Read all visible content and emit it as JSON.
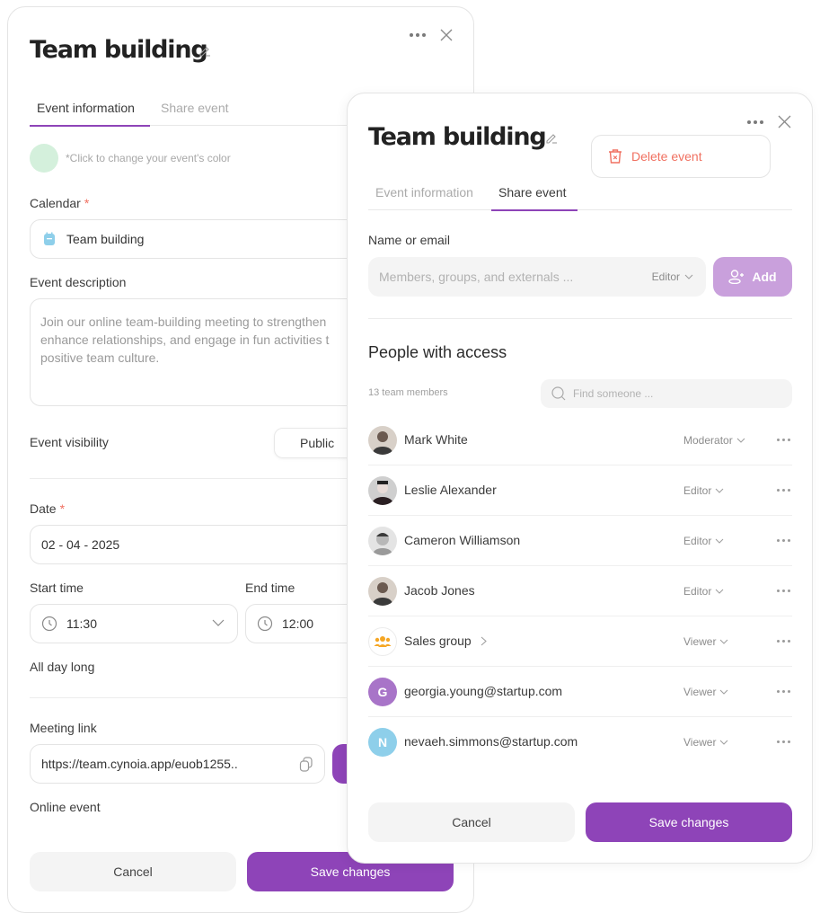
{
  "back_panel": {
    "title": "Team building",
    "tabs": [
      {
        "label": "Event information",
        "active": true
      },
      {
        "label": "Share event",
        "active": false
      }
    ],
    "color_hint": "*Click to change your event's color",
    "event_color": "#d4f0dc",
    "calendar": {
      "label": "Calendar",
      "required_mark": "*",
      "value": "Team building"
    },
    "description": {
      "label": "Event description",
      "value": "Join our online team-building meeting to strengthen collaboration, enhance relationships, and engage in fun activities that foster a positive team culture.",
      "lines": [
        "Join our online team-building meeting to strengthen",
        "enhance relationships, and engage in fun activities t",
        "positive team culture."
      ]
    },
    "visibility": {
      "label": "Event visibility",
      "value": "Public"
    },
    "date": {
      "label": "Date",
      "required_mark": "*",
      "value": "02 - 04 - 2025"
    },
    "start_time": {
      "label": "Start time",
      "value": "11:30"
    },
    "end_time": {
      "label": "End time",
      "value": "12:00"
    },
    "all_day": {
      "label": "All day long"
    },
    "meeting_link": {
      "label": "Meeting link",
      "value": "https://team.cynoia.app/euob1255.."
    },
    "online_event": {
      "label": "Online event"
    },
    "cancel_label": "Cancel",
    "save_label": "Save changes"
  },
  "front_panel": {
    "title": "Team building",
    "delete_label": "Delete event",
    "tabs": [
      {
        "label": "Event information",
        "active": false
      },
      {
        "label": "Share event",
        "active": true
      }
    ],
    "name_or_email": {
      "label": "Name or email",
      "placeholder": "Members, groups, and externals ...",
      "role": "Editor",
      "add_label": "Add"
    },
    "people_heading": "People with access",
    "member_count": "13 team members",
    "find_placeholder": "Find someone ...",
    "people": [
      {
        "name": "Mark White",
        "role": "Moderator",
        "avatar": "photo"
      },
      {
        "name": "Leslie Alexander",
        "role": "Editor",
        "avatar": "photo"
      },
      {
        "name": "Cameron Williamson",
        "role": "Editor",
        "avatar": "photo"
      },
      {
        "name": "Jacob Jones",
        "role": "Editor",
        "avatar": "photo"
      },
      {
        "name": "Sales group",
        "role": "Viewer",
        "avatar": "group"
      },
      {
        "name": "georgia.young@startup.com",
        "role": "Viewer",
        "avatar": "initial",
        "initial": "G",
        "avatar_color": "#a874c8"
      },
      {
        "name": "nevaeh.simmons@startup.com",
        "role": "Viewer",
        "avatar": "initial",
        "initial": "N",
        "avatar_color": "#8ecfea"
      }
    ],
    "cancel_label": "Cancel",
    "save_label": "Save changes"
  },
  "colors": {
    "accent": "#8e44b8",
    "accent_light": "#c9a0dc",
    "danger": "#f07060",
    "calendar_icon": "#8ecfea",
    "group_icon": "#f5a623"
  }
}
